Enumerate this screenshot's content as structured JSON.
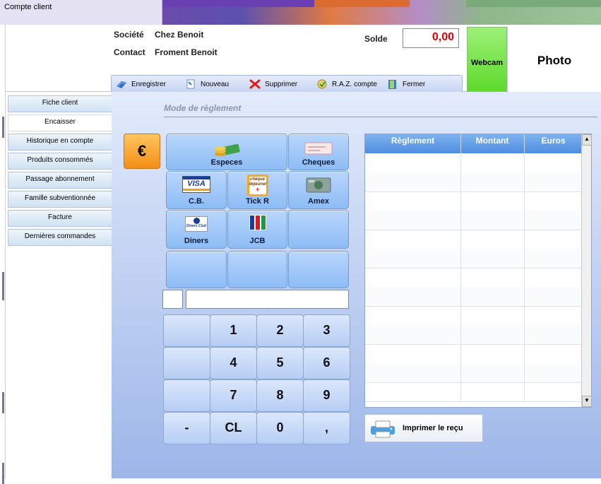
{
  "window": {
    "title": "Compte client"
  },
  "header": {
    "societe_label": "Société",
    "societe_value": "Chez Benoit",
    "contact_label": "Contact",
    "contact_value": "Froment Benoit",
    "solde_label": "Solde",
    "solde_value": "0,00",
    "webcam_label": "Webcam",
    "photo_label": "Photo"
  },
  "toolbar": {
    "save": "Enregistrer",
    "new": "Nouveau",
    "delete": "Supprimer",
    "reset": "R.A.Z. compte",
    "close": "Fermer"
  },
  "sidebar": {
    "items": [
      {
        "label": "Fiche client"
      },
      {
        "label": "Encaisser"
      },
      {
        "label": "Historique en compte"
      },
      {
        "label": "Produits consommés"
      },
      {
        "label": "Passage abonnement"
      },
      {
        "label": "Famille subventionnée"
      },
      {
        "label": "Facture"
      },
      {
        "label": "Dernières commandes"
      }
    ]
  },
  "payment": {
    "section_title": "Mode de règlement",
    "euro_symbol": "€",
    "methods": {
      "especes": "Especes",
      "cheques": "Cheques",
      "cb": "C.B.",
      "tickr": "Tick R",
      "amex": "Amex",
      "diners": "Diners",
      "jcb": "JCB"
    },
    "icons": {
      "visa_text": "VISA",
      "cheque_dej_line1": "chèque",
      "cheque_dej_line2": "déjeuner",
      "diners_text": "Diners Club",
      "jcb_text": "JCB"
    }
  },
  "keypad": {
    "keys": [
      "",
      "1",
      "2",
      "3",
      "",
      "4",
      "5",
      "6",
      "",
      "7",
      "8",
      "9",
      "-",
      "CL",
      "0",
      ","
    ]
  },
  "grid": {
    "columns": [
      "Règlement",
      "Montant",
      "Euros"
    ]
  },
  "print": {
    "label": "Imprimer le reçu"
  },
  "colors": {
    "accent": "#4d8de0",
    "solde": "#e00000",
    "webcam": "#5fd92d",
    "euro": "#f28e16"
  }
}
